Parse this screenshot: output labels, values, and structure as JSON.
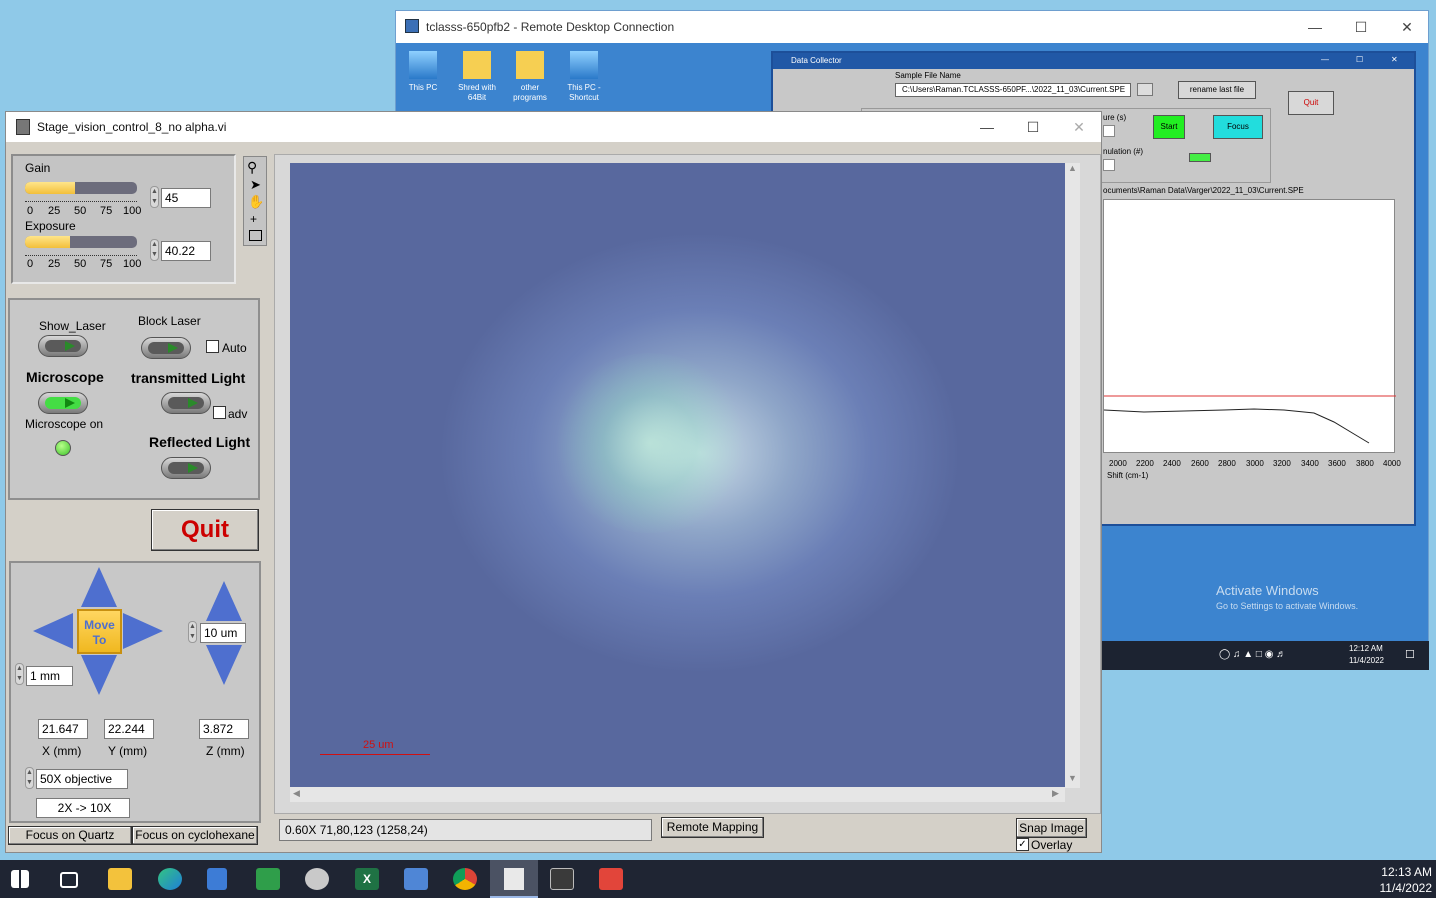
{
  "rdp": {
    "title": "tclasss-650pfb2 - Remote Desktop Connection",
    "desktop_icons": [
      "This PC",
      "Shred with 64Bit",
      "other programs",
      "This PC - Shortcut"
    ],
    "data_collector": {
      "title": "Data Collector",
      "sample_file_label": "Sample File Name",
      "sample_file_value": "C:\\Users\\Raman.TCLASSS-650PF...\\2022_11_03\\Current.SPE",
      "rename_button": "rename last file",
      "quit_button": "Quit",
      "exposure_label": "ure (s)",
      "accumulation_label": "nulation (#)",
      "start_button": "Start",
      "focus_button": "Focus",
      "path_text": "ocuments\\Raman Data\\Varger\\2022_11_03\\Current.SPE",
      "x_ticks": [
        "2000",
        "2200",
        "2400",
        "2600",
        "2800",
        "3000",
        "3200",
        "3400",
        "3600",
        "3800",
        "4000"
      ],
      "x_axis_label": "Shift (cm-1)"
    },
    "activate_windows": {
      "line1": "Activate Windows",
      "line2": "Go to Settings to activate Windows."
    },
    "tray_time": "12:12 AM",
    "tray_date": "11/4/2022"
  },
  "lv": {
    "title": "Stage_vision_control_8_no alpha.vi",
    "gain": {
      "label": "Gain",
      "value": "45",
      "level_percent": 45
    },
    "exposure": {
      "label": "Exposure",
      "value": "40.22",
      "level_percent": 40
    },
    "slider_ticks": [
      "0",
      "25",
      "50",
      "75",
      "100"
    ],
    "show_laser": "Show_Laser",
    "block_laser": "Block Laser",
    "auto_label": "Auto",
    "microscope": "Microscope",
    "transmitted_light": "transmitted Light",
    "adv_label": "adv",
    "microscope_on": "Microscope on",
    "reflected_light": "Reflected Light",
    "quit": "Quit",
    "move_to_line1": "Move",
    "move_to_line2": "To",
    "z_step": "10 um",
    "xy_step": "1 mm",
    "x_value": "21.647",
    "y_value": "22.244",
    "z_value": "3.872",
    "x_label": "X (mm)",
    "y_label": "Y (mm)",
    "z_label": "Z (mm)",
    "objective": "50X objective",
    "mag": "2X -> 10X",
    "focus_quartz": "Focus on Quartz",
    "focus_cyclohexane": "Focus on cyclohexane",
    "scale_bar_label": "25 um",
    "status_readout": "0.60X 71,80,123    (1258,24)",
    "remote_mapping": "Remote Mapping",
    "snap_image": "Snap Image",
    "overlay": "Overlay"
  },
  "taskbar": {
    "time": "12:13 AM",
    "date": "11/4/2022"
  },
  "colors": {
    "quit_red": "#cc0000",
    "led_green": "#44dd44",
    "start_green": "#22ee22",
    "focus_cyan": "#22dddd"
  }
}
